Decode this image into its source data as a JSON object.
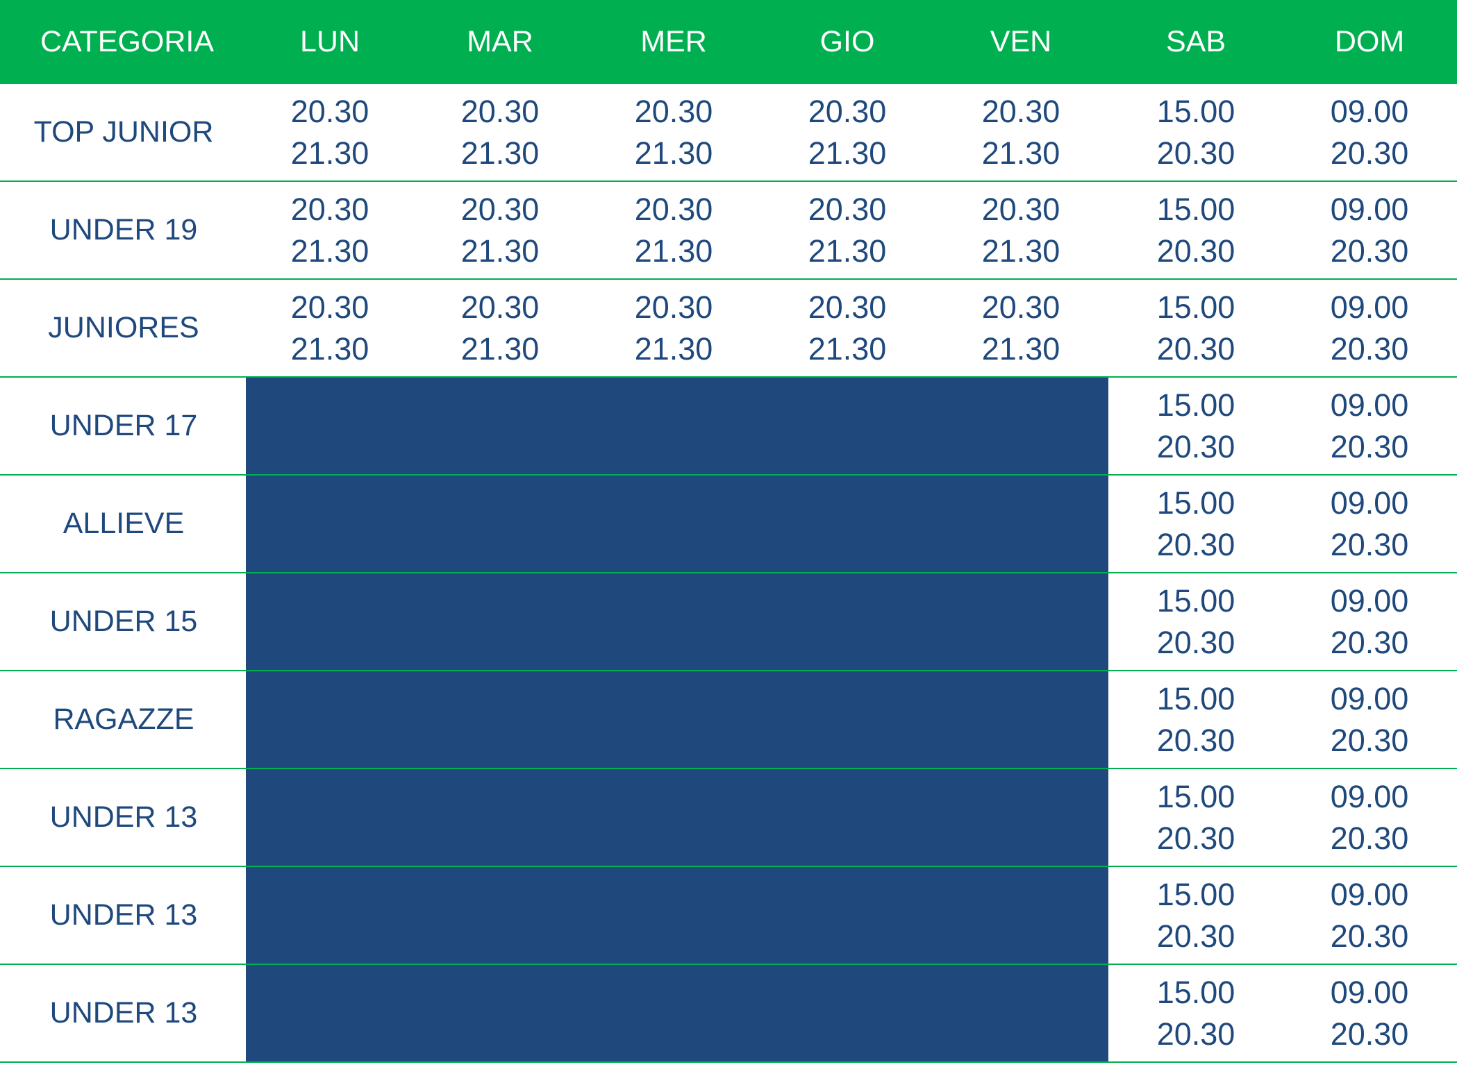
{
  "colors": {
    "header_bg": "#00b050",
    "header_text": "#ffffff",
    "body_text": "#1f497d",
    "blocked_fill": "#1f497d",
    "row_divider": "#00b050"
  },
  "header": [
    "CATEGORIA",
    "LUN",
    "MAR",
    "MER",
    "GIO",
    "VEN",
    "SAB",
    "DOM"
  ],
  "rows": [
    {
      "category": "TOP JUNIOR",
      "blocked": false,
      "times": [
        [
          "20.30",
          "21.30"
        ],
        [
          "20.30",
          "21.30"
        ],
        [
          "20.30",
          "21.30"
        ],
        [
          "20.30",
          "21.30"
        ],
        [
          "20.30",
          "21.30"
        ],
        [
          "15.00",
          "20.30"
        ],
        [
          "09.00",
          "20.30"
        ]
      ]
    },
    {
      "category": "UNDER 19",
      "blocked": false,
      "times": [
        [
          "20.30",
          "21.30"
        ],
        [
          "20.30",
          "21.30"
        ],
        [
          "20.30",
          "21.30"
        ],
        [
          "20.30",
          "21.30"
        ],
        [
          "20.30",
          "21.30"
        ],
        [
          "15.00",
          "20.30"
        ],
        [
          "09.00",
          "20.30"
        ]
      ]
    },
    {
      "category": "JUNIORES",
      "blocked": false,
      "times": [
        [
          "20.30",
          "21.30"
        ],
        [
          "20.30",
          "21.30"
        ],
        [
          "20.30",
          "21.30"
        ],
        [
          "20.30",
          "21.30"
        ],
        [
          "20.30",
          "21.30"
        ],
        [
          "15.00",
          "20.30"
        ],
        [
          "09.00",
          "20.30"
        ]
      ]
    },
    {
      "category": "UNDER 17",
      "blocked": true,
      "times": [
        [
          "15.00",
          "20.30"
        ],
        [
          "09.00",
          "20.30"
        ]
      ]
    },
    {
      "category": "ALLIEVE",
      "blocked": true,
      "times": [
        [
          "15.00",
          "20.30"
        ],
        [
          "09.00",
          "20.30"
        ]
      ]
    },
    {
      "category": "UNDER 15",
      "blocked": true,
      "times": [
        [
          "15.00",
          "20.30"
        ],
        [
          "09.00",
          "20.30"
        ]
      ]
    },
    {
      "category": "RAGAZZE",
      "blocked": true,
      "times": [
        [
          "15.00",
          "20.30"
        ],
        [
          "09.00",
          "20.30"
        ]
      ]
    },
    {
      "category": "UNDER 13",
      "blocked": true,
      "times": [
        [
          "15.00",
          "20.30"
        ],
        [
          "09.00",
          "20.30"
        ]
      ]
    },
    {
      "category": "UNDER 13",
      "blocked": true,
      "times": [
        [
          "15.00",
          "20.30"
        ],
        [
          "09.00",
          "20.30"
        ]
      ]
    },
    {
      "category": "UNDER 13",
      "blocked": true,
      "times": [
        [
          "15.00",
          "20.30"
        ],
        [
          "09.00",
          "20.30"
        ]
      ]
    }
  ]
}
